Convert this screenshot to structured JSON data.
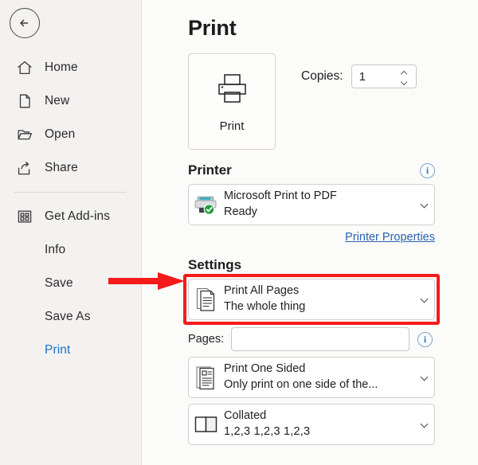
{
  "app": {
    "accent_blue": "#1f6fc4",
    "highlight_red": "#f51b1b",
    "link_blue": "#2a62b0",
    "sidebar_bg": "#f3f2f1",
    "main_bg": "#fbfbfa"
  },
  "sidebar": {
    "back_label": "Back",
    "items": [
      {
        "label": "Home",
        "icon": "home-icon",
        "has_icon": true,
        "active": false
      },
      {
        "label": "New",
        "icon": "new-document-icon",
        "has_icon": true,
        "active": false
      },
      {
        "label": "Open",
        "icon": "open-folder-icon",
        "has_icon": true,
        "active": false
      },
      {
        "label": "Share",
        "icon": "share-icon",
        "has_icon": true,
        "active": false
      },
      {
        "label": "Get Add-ins",
        "icon": "add-ins-grid-icon",
        "has_icon": true,
        "active": false
      },
      {
        "label": "Info",
        "icon": "",
        "has_icon": false,
        "active": false
      },
      {
        "label": "Save",
        "icon": "",
        "has_icon": false,
        "active": false
      },
      {
        "label": "Save As",
        "icon": "",
        "has_icon": false,
        "active": false
      },
      {
        "label": "Print",
        "icon": "",
        "has_icon": false,
        "active": true
      }
    ]
  },
  "main": {
    "title": "Print",
    "print_button": {
      "label": "Print",
      "icon": "printer-icon"
    },
    "copies": {
      "label": "Copies:",
      "value": "1",
      "up_icon": "chevron-up-icon",
      "down_icon": "chevron-down-icon"
    },
    "printer_section": {
      "heading": "Printer",
      "info_icon": "info-icon",
      "info_glyph": "i",
      "selected": {
        "name": "Microsoft Print to PDF",
        "status": "Ready",
        "icon": "printer-device-icon",
        "badge": "ready-check-badge",
        "caret": "chevron-down-icon"
      },
      "properties_link": "Printer Properties"
    },
    "settings_section": {
      "heading": "Settings",
      "print_range": {
        "primary": "Print All Pages",
        "secondary": "The whole thing",
        "icon": "document-pages-icon",
        "caret": "chevron-down-icon",
        "highlighted": true
      },
      "pages": {
        "label": "Pages:",
        "value": "",
        "placeholder": "",
        "info_icon": "info-icon",
        "info_glyph": "i"
      },
      "sides": {
        "primary": "Print One Sided",
        "secondary": "Only print on one side of the...",
        "icon": "one-sided-page-icon",
        "caret": "chevron-down-icon"
      },
      "collation": {
        "primary": "Collated",
        "secondary": "1,2,3   1,2,3   1,2,3",
        "icon": "collated-pages-icon",
        "caret": "chevron-down-icon"
      }
    }
  },
  "annotation": {
    "arrow": {
      "name": "red-pointer-arrow",
      "color": "#f51b1b",
      "points_to": "Settings"
    }
  }
}
